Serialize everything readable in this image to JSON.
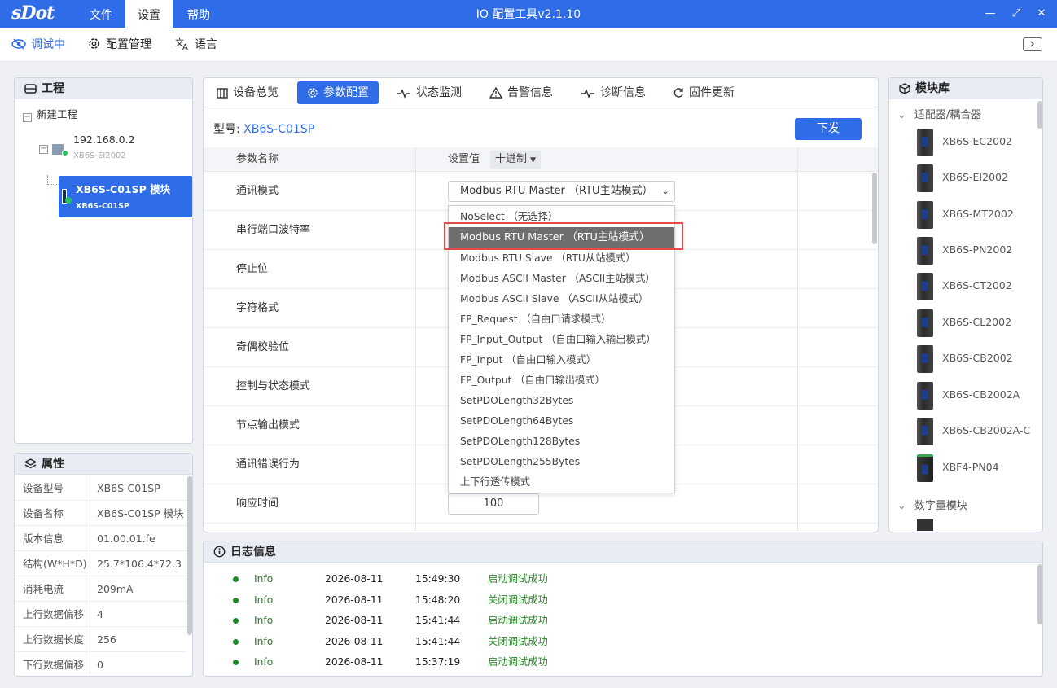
{
  "app": {
    "logo": "sDot",
    "title": "IO 配置工具v2.1.10"
  },
  "menu": {
    "file": "文件",
    "settings": "设置",
    "help": "帮助"
  },
  "toolbar": {
    "debug": "调试中",
    "config_mgmt": "配置管理",
    "language": "语言"
  },
  "project": {
    "title": "工程",
    "root": "新建工程",
    "device_ip": "192.168.0.2",
    "device_model": "XB6S-EI2002",
    "module_name": "XB6S-C01SP 模块",
    "module_model": "XB6S-C01SP"
  },
  "attributes": {
    "title": "属性",
    "rows": [
      {
        "key": "设备型号",
        "value": "XB6S-C01SP"
      },
      {
        "key": "设备名称",
        "value": "XB6S-C01SP 模块"
      },
      {
        "key": "版本信息",
        "value": "01.00.01.fe"
      },
      {
        "key": "结构(W*H*D)",
        "value": "25.7*106.4*72.3"
      },
      {
        "key": "消耗电流",
        "value": "209mA"
      },
      {
        "key": "上行数据偏移",
        "value": "4"
      },
      {
        "key": "上行数据长度",
        "value": "256"
      },
      {
        "key": "下行数据偏移",
        "value": "0"
      }
    ]
  },
  "tabs": [
    "设备总览",
    "参数配置",
    "状态监测",
    "告警信息",
    "诊断信息",
    "固件更新"
  ],
  "active_tab": "参数配置",
  "model": {
    "label": "型号:",
    "value": "XB6S-C01SP"
  },
  "download_button": "下发",
  "param_table": {
    "header_name": "参数名称",
    "header_value": "设置值",
    "radix": "十进制",
    "rows": [
      "通讯模式",
      "串行端口波特率",
      "停止位",
      "字符格式",
      "奇偶校验位",
      "控制与状态模式",
      "节点输出模式",
      "通讯错误行为",
      "响应时间"
    ],
    "comm_mode_value": "Modbus RTU Master （RTU主站模式）",
    "response_time_value": "100"
  },
  "dropdown": {
    "selected": "Modbus RTU Master （RTU主站模式）",
    "options": [
      "NoSelect （无选择）",
      "Modbus RTU Master （RTU主站模式）",
      "Modbus RTU Slave （RTU从站模式）",
      "Modbus ASCII Master （ASCII主站模式）",
      "Modbus ASCII Slave （ASCII从站模式）",
      "FP_Request （自由口请求模式）",
      "FP_Input_Output （自由口输入输出模式）",
      "FP_Input （自由口输入模式）",
      "FP_Output （自由口输出模式）",
      "SetPDOLength32Bytes",
      "SetPDOLength64Bytes",
      "SetPDOLength128Bytes",
      "SetPDOLength255Bytes",
      "上下行透传模式"
    ]
  },
  "library": {
    "title": "模块库",
    "group1": "适配器/耦合器",
    "items": [
      "XB6S-EC2002",
      "XB6S-EI2002",
      "XB6S-MT2002",
      "XB6S-PN2002",
      "XB6S-CT2002",
      "XB6S-CL2002",
      "XB6S-CB2002",
      "XB6S-CB2002A",
      "XB6S-CB2002A-C",
      "XBF4-PN04"
    ],
    "group2": "数字量模块"
  },
  "log": {
    "title": "日志信息",
    "rows": [
      {
        "level": "Info",
        "date": "2026-08-11",
        "time": "15:49:30",
        "msg": "启动调试成功"
      },
      {
        "level": "Info",
        "date": "2026-08-11",
        "time": "15:48:20",
        "msg": "关闭调试成功"
      },
      {
        "level": "Info",
        "date": "2026-08-11",
        "time": "15:41:44",
        "msg": "启动调试成功"
      },
      {
        "level": "Info",
        "date": "2026-08-11",
        "time": "15:41:44",
        "msg": "关闭调试成功"
      },
      {
        "level": "Info",
        "date": "2026-08-11",
        "time": "15:37:19",
        "msg": "启动调试成功"
      }
    ]
  },
  "colors": {
    "accent": "#2f6de8",
    "highlight": "#e24b45",
    "ok": "#1a8a2a"
  }
}
